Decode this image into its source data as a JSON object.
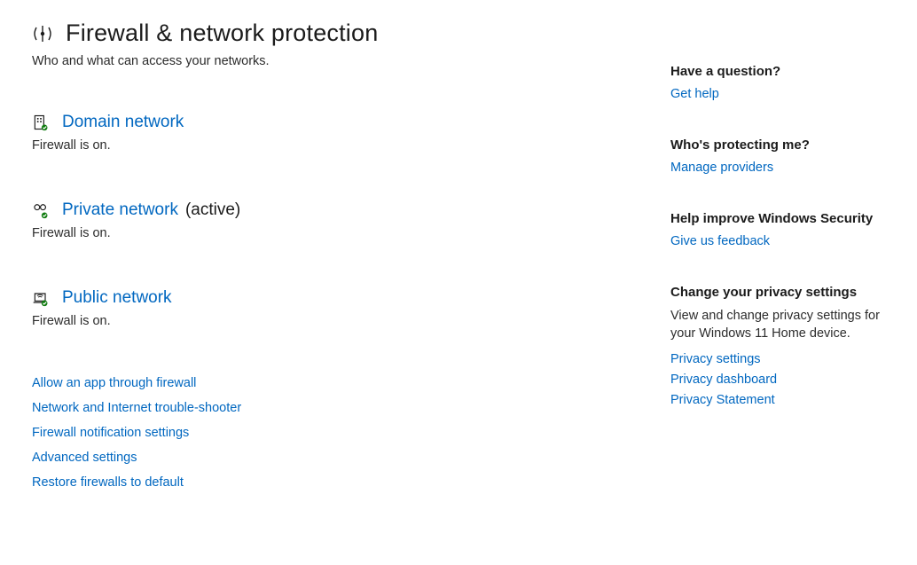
{
  "header": {
    "title": "Firewall & network protection",
    "subtitle": "Who and what can access your networks."
  },
  "networks": {
    "domain": {
      "label": "Domain network",
      "status": "Firewall is on.",
      "active": ""
    },
    "private": {
      "label": "Private network",
      "status": "Firewall is on.",
      "active": "(active)"
    },
    "public": {
      "label": "Public network",
      "status": "Firewall is on.",
      "active": ""
    }
  },
  "actions": {
    "allow_app": "Allow an app through firewall",
    "troubleshoot": "Network and Internet trouble-shooter",
    "notifications": "Firewall notification settings",
    "advanced": "Advanced settings",
    "restore": "Restore firewalls to default"
  },
  "aside": {
    "question": {
      "heading": "Have a question?",
      "link": "Get help"
    },
    "protecting": {
      "heading": "Who's protecting me?",
      "link": "Manage providers"
    },
    "improve": {
      "heading": "Help improve Windows Security",
      "link": "Give us feedback"
    },
    "privacy": {
      "heading": "Change your privacy settings",
      "desc": "View and change privacy settings for your Windows 11 Home device.",
      "links": {
        "settings": "Privacy settings",
        "dashboard": "Privacy dashboard",
        "statement": "Privacy Statement"
      }
    }
  }
}
